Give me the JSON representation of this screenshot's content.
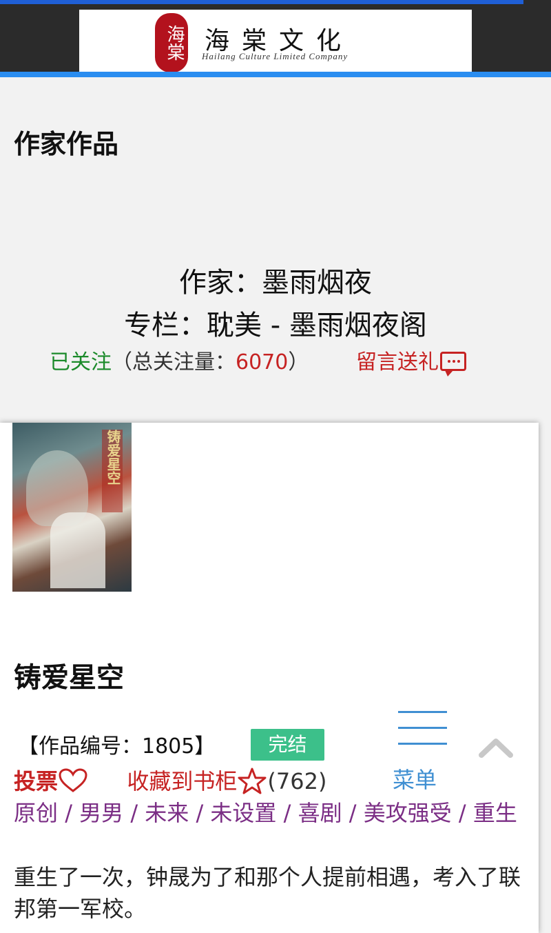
{
  "header": {
    "logo_seal": "海棠",
    "logo_cn": "海棠文化",
    "logo_en": "Hailang Culture Limited Company"
  },
  "page": {
    "section_title": "作家作品"
  },
  "author": {
    "line1": "作家：墨雨烟夜",
    "line2": "专栏：耽美 - 墨雨烟夜阁",
    "followed_label": "已关注",
    "follow_count_prefix": "（总关注量：",
    "follow_count": "6070",
    "follow_count_suffix": "）",
    "message_gift_label": "留言送礼"
  },
  "book": {
    "cover_title": "铸爱星空",
    "title": "铸爱星空",
    "work_id_label": "【作品编号：1805】",
    "status": "完结",
    "vote_label": "投票",
    "collect_label": "收藏到书柜",
    "collect_count": "(762)",
    "tags": [
      "原创",
      "男男",
      "未来",
      "未设置",
      "喜剧",
      "美攻强受",
      "重生"
    ],
    "intro": "重生了一次，钟晟为了和那个人提前相遇，考入了联邦第一军校。"
  },
  "nav": {
    "menu_label": "菜单",
    "menu_icon": "hamburger-icon",
    "back_to_top_icon": "chevron-up-icon"
  },
  "colors": {
    "brand_blue": "#2a8df0",
    "followed_green": "#1b8a2a",
    "accent_red": "#c62323",
    "tag_purple": "#7b2e85",
    "status_green": "#3cc08a",
    "menu_blue": "#3f8fd2"
  }
}
